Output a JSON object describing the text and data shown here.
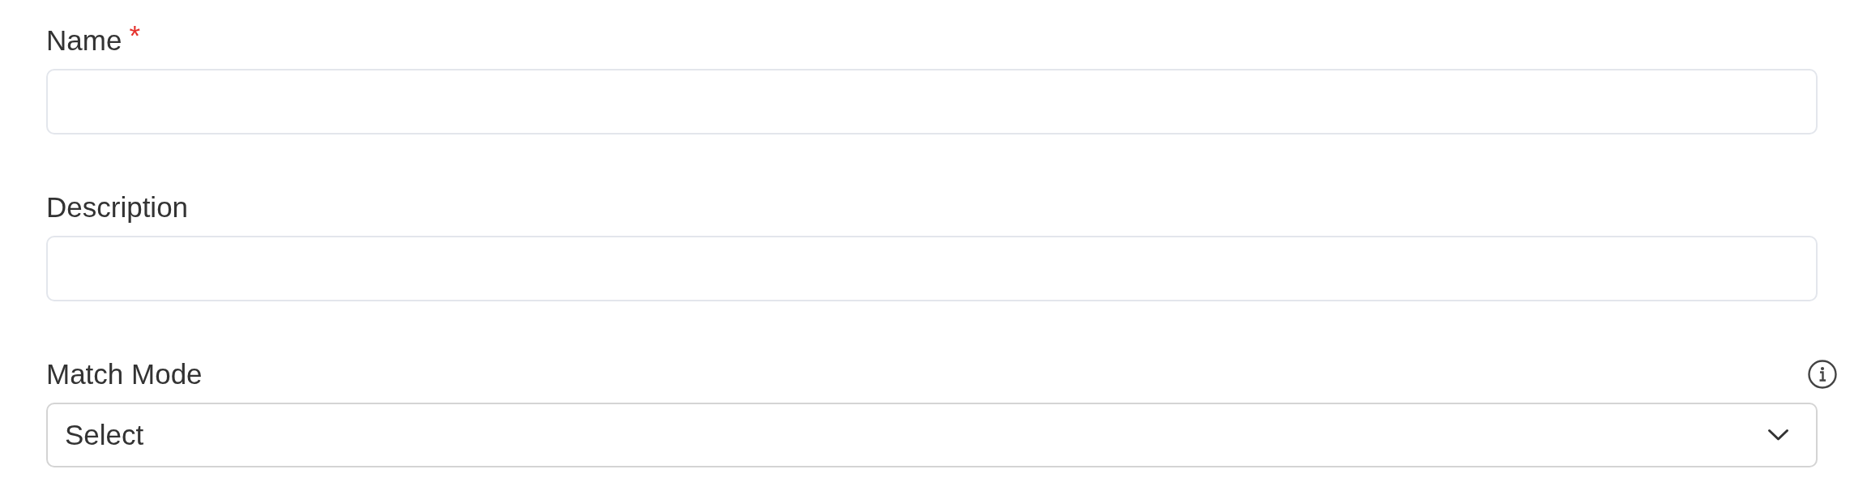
{
  "form": {
    "fields": [
      {
        "kind": "text",
        "label": "Name",
        "required_mark": "*",
        "info": false
      },
      {
        "kind": "text",
        "label": "Description",
        "info": false
      },
      {
        "kind": "select",
        "label": "Match Mode",
        "info": true,
        "placeholder": "Select"
      }
    ]
  }
}
